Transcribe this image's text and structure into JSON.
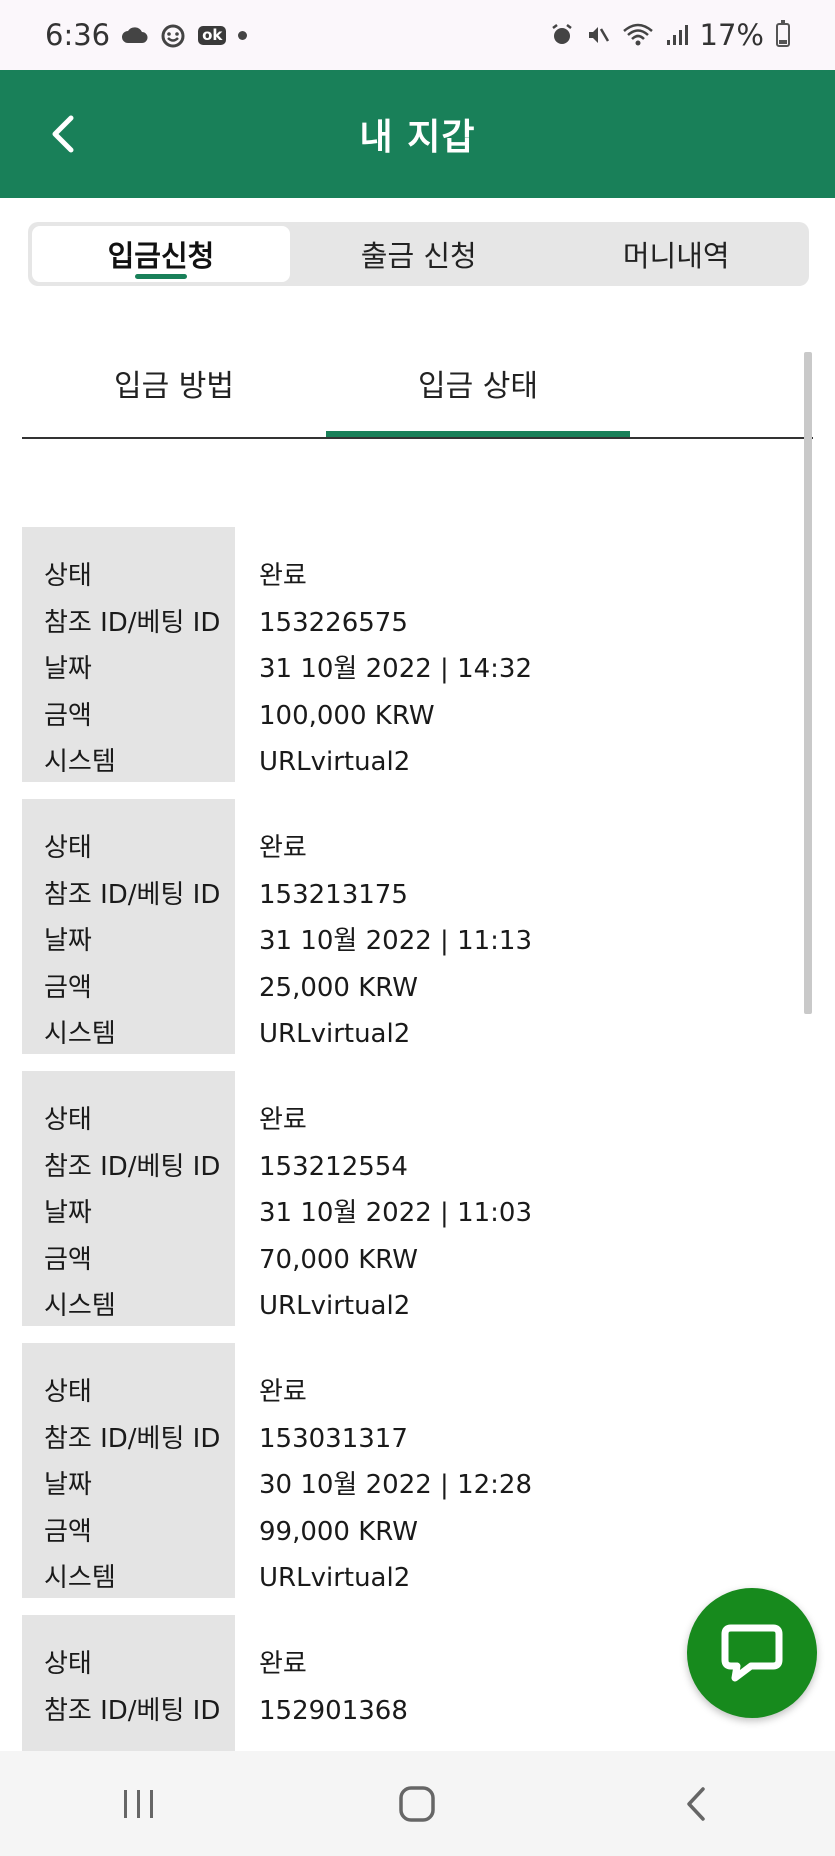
{
  "status_bar": {
    "time": "6:36",
    "ok_badge": "ok",
    "battery": "17%"
  },
  "header": {
    "title": "내 지갑"
  },
  "segments": [
    {
      "label": "입금신청",
      "active": true
    },
    {
      "label": "출금 신청",
      "active": false
    },
    {
      "label": "머니내역",
      "active": false
    }
  ],
  "subtabs": [
    {
      "label": "입금 방법",
      "active": false
    },
    {
      "label": "입금 상태",
      "active": true
    }
  ],
  "field_labels": [
    "상태",
    "참조 ID/베팅 ID",
    "날짜",
    "금액",
    "시스템"
  ],
  "records": [
    {
      "status": "완료",
      "ref_id": "153226575",
      "date": "31 10월 2022 | 14:32",
      "amount": "100,000 KRW",
      "system": "URLvirtual2"
    },
    {
      "status": "완료",
      "ref_id": "153213175",
      "date": "31 10월 2022 | 11:13",
      "amount": "25,000 KRW",
      "system": "URLvirtual2"
    },
    {
      "status": "완료",
      "ref_id": "153212554",
      "date": "31 10월 2022 | 11:03",
      "amount": "70,000 KRW",
      "system": "URLvirtual2"
    },
    {
      "status": "완료",
      "ref_id": "153031317",
      "date": "30 10월 2022 | 12:28",
      "amount": "99,000 KRW",
      "system": "URLvirtual2"
    },
    {
      "status": "완료",
      "ref_id": "152901368"
    }
  ],
  "colors": {
    "brand_green": "#198059",
    "chat_button": "#178a1d",
    "label_bg": "#e4e4e4"
  },
  "icons": {
    "back": "chevron-left-icon",
    "chat": "chat-bubble-icon",
    "nav_recent": "recent-apps-icon",
    "nav_home": "home-icon",
    "nav_back": "nav-back-icon"
  }
}
